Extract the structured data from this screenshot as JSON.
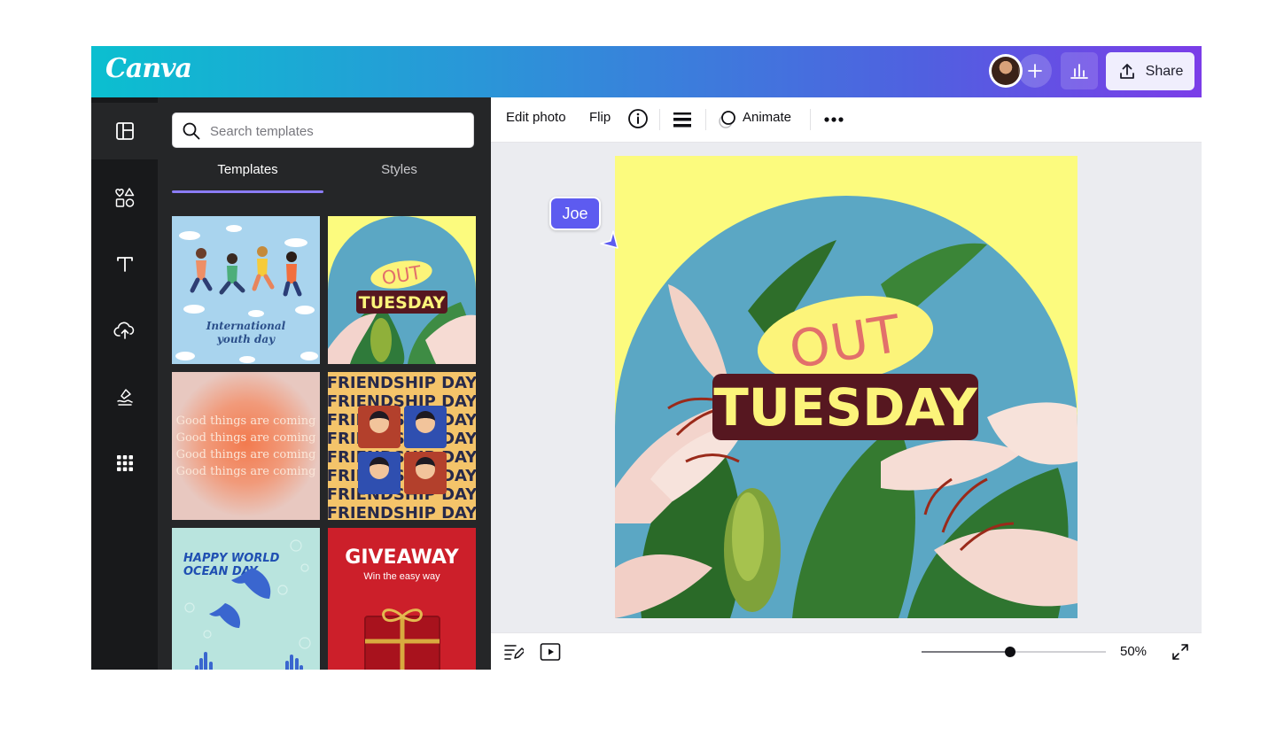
{
  "header": {
    "logo": "Canva",
    "share_label": "Share"
  },
  "rail": {
    "items": [
      "templates-icon",
      "elements-icon",
      "text-icon",
      "uploads-icon",
      "draw-icon",
      "apps-icon"
    ],
    "active_index": 0
  },
  "panel": {
    "search_placeholder": "Search templates",
    "tabs": [
      {
        "label": "Templates",
        "active": true
      },
      {
        "label": "Styles",
        "active": false
      }
    ],
    "templates": {
      "t1": [
        "International",
        "youth day"
      ],
      "t2": {
        "top": "OUT",
        "bottom": "TUESDAY"
      },
      "t3": [
        "Good things are coming",
        "Good things are coming",
        "Good things are coming",
        "Good things are coming"
      ],
      "t4": [
        "FRIENDSHIP DAY",
        "FRIENDSHIP DAY",
        "FRIENDSHIP DAY",
        "FRIENDSHIP DAY",
        "FRIENDSHIP DAY",
        "FRIENDSHIP DAY",
        "FRIENDSHIP DAY",
        "FRIENDSHIP DAY"
      ],
      "t5": [
        "HAPPY WORLD",
        "OCEAN DAY"
      ],
      "t6": {
        "title": "GIVEAWAY",
        "subtitle": "Win the easy way"
      }
    }
  },
  "toolbar": {
    "edit_photo": "Edit photo",
    "flip": "Flip",
    "animate": "Animate"
  },
  "canvas": {
    "top_word": "OUT",
    "bottom_word": "TUESDAY",
    "background_color": "#fcfb7e",
    "arch_color": "#5ba7c4"
  },
  "collaborator": {
    "name": "Joe",
    "color": "#5d5bf0"
  },
  "footer": {
    "zoom_label": "50%",
    "zoom_slider_fraction": 0.48
  }
}
